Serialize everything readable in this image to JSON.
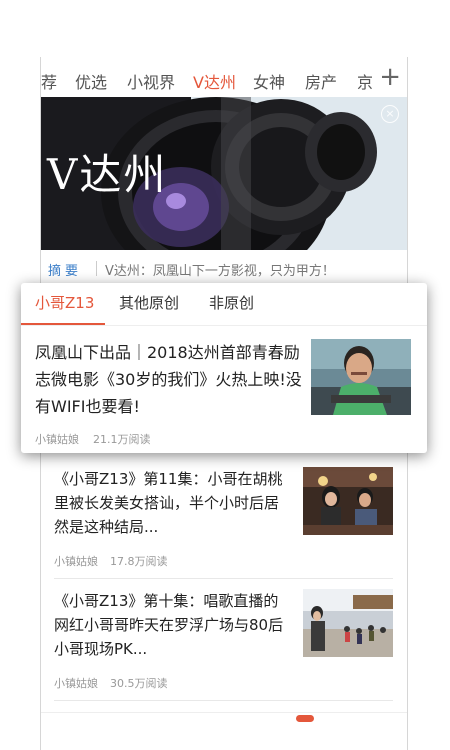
{
  "nav": {
    "tabs": [
      "荐",
      "优选",
      "小视界",
      "V达州",
      "女神",
      "房产",
      "京"
    ],
    "active_tab": "V达州",
    "add_icon": "plus-icon"
  },
  "banner": {
    "title": "V达州"
  },
  "summary": {
    "tag": "摘要",
    "text": "V达州：凤凰山下一方影视，只为甲方！"
  },
  "card": {
    "tabs": [
      "小哥Z13",
      "其他原创",
      "非原创"
    ],
    "active_tab": "小哥Z13",
    "article": {
      "title": "凤凰山下出品｜2018达州首部青春励志微电影《30岁的我们》火热上映!没有WIFI也要看!",
      "author": "小镇姑娘",
      "reads": "21.1万阅读"
    }
  },
  "list": [
    {
      "title": "《小哥Z13》第11集：小哥在胡桃里被长发美女搭讪，半个小时后居然是这种结局...",
      "author": "小镇姑娘",
      "reads": "17.8万阅读"
    },
    {
      "title": "《小哥Z13》第十集：唱歌直播的网红小哥哥昨天在罗浮广场与80后小哥现场PK...",
      "author": "小镇姑娘",
      "reads": "30.5万阅读"
    }
  ],
  "colors": {
    "accent": "#e4573b",
    "summary_tag": "#3c7fc9"
  }
}
